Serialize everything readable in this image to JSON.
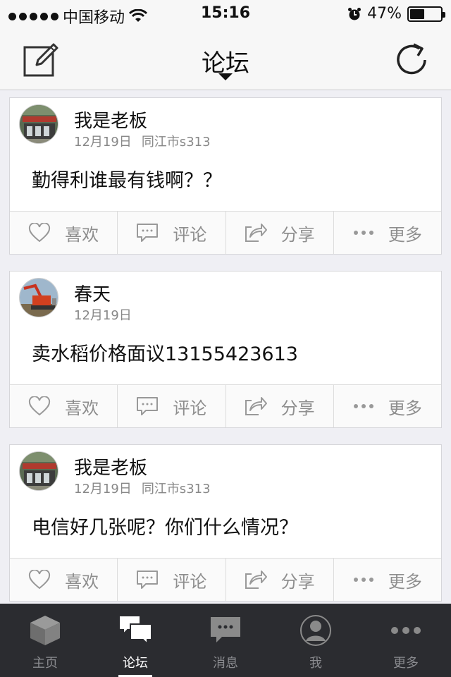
{
  "status_bar": {
    "carrier": "中国移动",
    "time": "15:16",
    "battery_text": "47%",
    "battery_level": 0.47
  },
  "nav": {
    "title": "论坛"
  },
  "posts": [
    {
      "author": "我是老板",
      "date": "12月19日",
      "location": "同江市s313",
      "content": "勤得利谁最有钱啊？？"
    },
    {
      "author": "春天",
      "date": "12月19日",
      "location": "",
      "content": "卖水稻价格面议13155423613"
    },
    {
      "author": "我是老板",
      "date": "12月19日",
      "location": "同江市s313",
      "content": "电信好几张呢？你们什么情况？"
    }
  ],
  "actions": {
    "like": "喜欢",
    "comment": "评论",
    "share": "分享",
    "more": "更多"
  },
  "tabs": [
    {
      "label": "主页",
      "icon": "cube-icon"
    },
    {
      "label": "论坛",
      "icon": "chat-bubbles-icon",
      "active": true
    },
    {
      "label": "消息",
      "icon": "message-icon"
    },
    {
      "label": "我",
      "icon": "user-icon"
    },
    {
      "label": "更多",
      "icon": "more-dots-icon"
    }
  ],
  "colors": {
    "background": "#efeff4",
    "tab_bar": "#2b2c30",
    "action_text": "#8e8e8e"
  }
}
